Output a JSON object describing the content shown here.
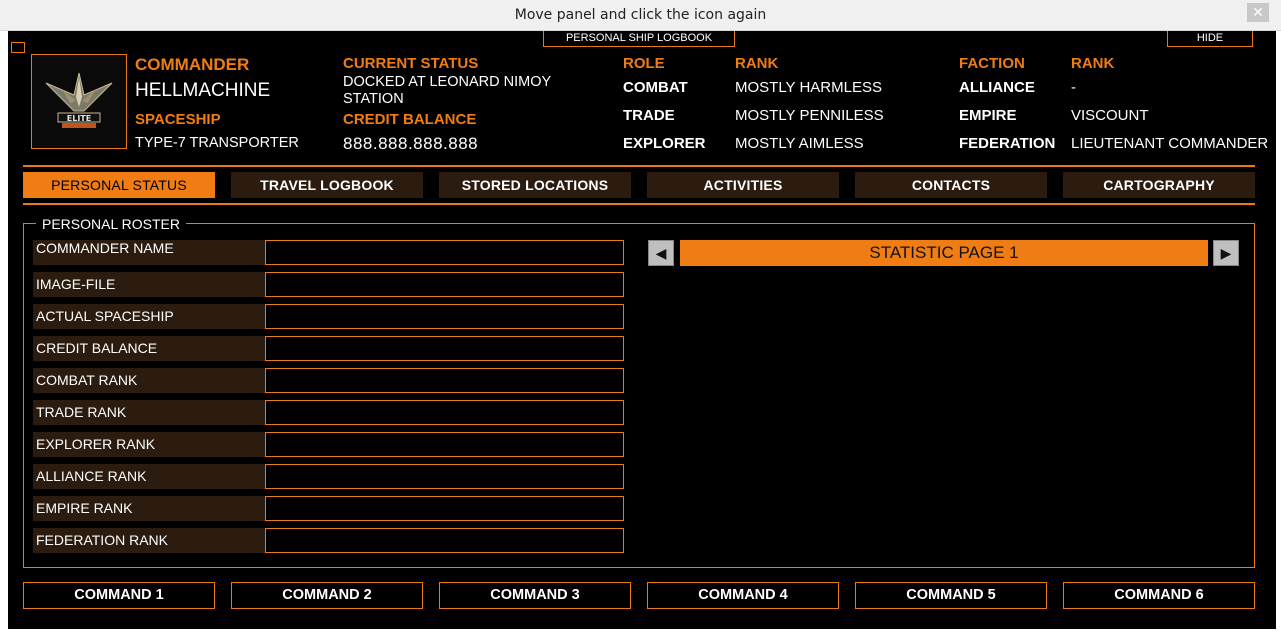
{
  "window": {
    "title": "Move panel and click the icon again",
    "close_glyph": "✕"
  },
  "panel": {
    "logbook_title": "PERSONAL SHIP LOGBOOK",
    "hide_label": "HIDE"
  },
  "header": {
    "commander_label": "COMMANDER",
    "commander_name": "HELLMACHINE",
    "spaceship_label": "SPACESHIP",
    "spaceship_name": "TYPE-7 TRANSPORTER",
    "current_status_label": "CURRENT STATUS",
    "current_status_line1": "DOCKED AT LEONARD NIMOY",
    "current_status_line2": "STATION",
    "credit_label": "CREDIT BALANCE",
    "credit_value": "888.888.888.888",
    "role_label": "ROLE",
    "role_rank_label": "RANK",
    "roles": [
      {
        "role": "COMBAT",
        "rank": "MOSTLY HARMLESS"
      },
      {
        "role": "TRADE",
        "rank": "MOSTLY PENNILESS"
      },
      {
        "role": "EXPLORER",
        "rank": "MOSTLY AIMLESS"
      }
    ],
    "faction_label": "FACTION",
    "faction_rank_label": "RANK",
    "factions": [
      {
        "faction": "ALLIANCE",
        "rank": "-"
      },
      {
        "faction": "EMPIRE",
        "rank": "VISCOUNT"
      },
      {
        "faction": "FEDERATION",
        "rank": "LIEUTENANT COMMANDER"
      }
    ]
  },
  "tabs": [
    {
      "label": "PERSONAL STATUS",
      "active": true
    },
    {
      "label": "TRAVEL LOGBOOK",
      "active": false
    },
    {
      "label": "STORED LOCATIONS",
      "active": false
    },
    {
      "label": "ACTIVITIES",
      "active": false
    },
    {
      "label": "CONTACTS",
      "active": false
    },
    {
      "label": "CARTOGRAPHY",
      "active": false
    }
  ],
  "roster": {
    "legend": "PERSONAL ROSTER",
    "fields": [
      {
        "label": "COMMANDER NAME",
        "value": ""
      },
      {
        "label": "IMAGE-FILE",
        "value": ""
      },
      {
        "label": "ACTUAL SPACESHIP",
        "value": ""
      },
      {
        "label": "CREDIT BALANCE",
        "value": ""
      },
      {
        "label": "COMBAT RANK",
        "value": ""
      },
      {
        "label": "TRADE RANK",
        "value": ""
      },
      {
        "label": "EXPLORER RANK",
        "value": ""
      },
      {
        "label": "ALLIANCE RANK",
        "value": ""
      },
      {
        "label": "EMPIRE RANK",
        "value": ""
      },
      {
        "label": "FEDERATION RANK",
        "value": ""
      }
    ],
    "statistic_page": "STATISTIC PAGE 1",
    "prev_glyph": "◀",
    "next_glyph": "▶"
  },
  "commands": [
    {
      "label": "COMMAND 1"
    },
    {
      "label": "COMMAND 2"
    },
    {
      "label": "COMMAND 3"
    },
    {
      "label": "COMMAND 4"
    },
    {
      "label": "COMMAND 5"
    },
    {
      "label": "COMMAND 6"
    }
  ],
  "colors": {
    "accent": "#f07d14",
    "panel_bg": "#000000",
    "tab_bg": "#2b1c0f"
  },
  "logo": {
    "icon": "elite-dangerous-logo"
  }
}
